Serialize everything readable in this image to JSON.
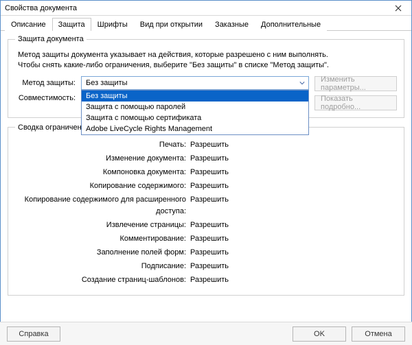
{
  "window": {
    "title": "Свойства документа"
  },
  "tabs": {
    "items": [
      {
        "label": "Описание"
      },
      {
        "label": "Защита"
      },
      {
        "label": "Шрифты"
      },
      {
        "label": "Вид при открытии"
      },
      {
        "label": "Заказные"
      },
      {
        "label": "Дополнительные"
      }
    ],
    "active_index": 1
  },
  "protection_group": {
    "legend": "Защита документа",
    "desc_line1": "Метод защиты документа указывает на действия, которые разрешено с ним выполнять.",
    "desc_line2": "Чтобы снять какие-либо ограничения, выберите \"Без защиты\" в списке \"Метод защиты\".",
    "method_label": "Метод защиты:",
    "method_value": "Без защиты",
    "method_options": [
      "Без защиты",
      "Защита с помощью паролей",
      "Защита с помощью сертификата",
      "Adobe LiveCycle Rights Management"
    ],
    "compat_label": "Совместимость:",
    "change_params_btn": "Изменить параметры...",
    "show_detail_btn": "Показать подробно..."
  },
  "restrictions_group": {
    "legend": "Сводка ограничений документа",
    "rows": [
      {
        "label": "Печать:",
        "value": "Разрешить"
      },
      {
        "label": "Изменение документа:",
        "value": "Разрешить"
      },
      {
        "label": "Компоновка документа:",
        "value": "Разрешить"
      },
      {
        "label": "Копирование содержимого:",
        "value": "Разрешить"
      },
      {
        "label": "Копирование содержимого для расширенного доступа:",
        "value": "Разрешить"
      },
      {
        "label": "Извлечение страницы:",
        "value": "Разрешить"
      },
      {
        "label": "Комментирование:",
        "value": "Разрешить"
      },
      {
        "label": "Заполнение полей форм:",
        "value": "Разрешить"
      },
      {
        "label": "Подписание:",
        "value": "Разрешить"
      },
      {
        "label": "Создание страниц-шаблонов:",
        "value": "Разрешить"
      }
    ]
  },
  "buttons": {
    "help": "Справка",
    "ok": "OK",
    "cancel": "Отмена"
  }
}
